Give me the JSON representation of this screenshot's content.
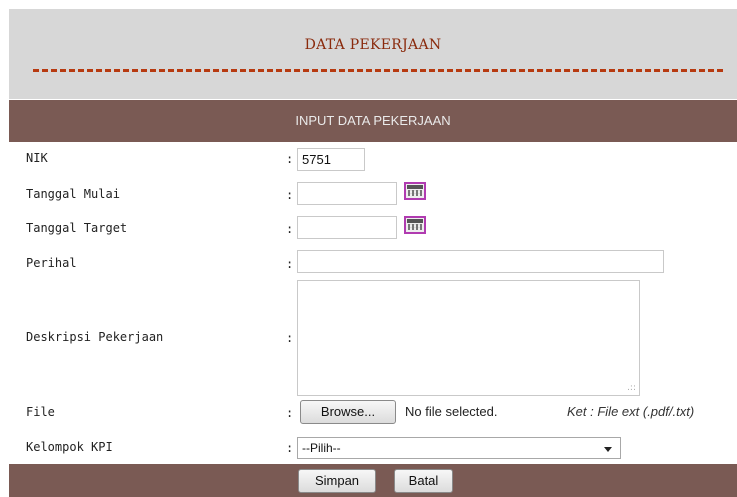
{
  "header": {
    "title": "DATA PEKERJAAN"
  },
  "subheader": {
    "title": "INPUT DATA PEKERJAAN"
  },
  "form": {
    "colon": ":",
    "nik": {
      "label": "NIK",
      "value": "5751"
    },
    "tanggal_mulai": {
      "label": "Tanggal Mulai",
      "value": ""
    },
    "tanggal_target": {
      "label": "Tanggal Target",
      "value": ""
    },
    "perihal": {
      "label": "Perihal",
      "value": ""
    },
    "deskripsi": {
      "label": "Deskripsi Pekerjaan",
      "value": ""
    },
    "file": {
      "label": "File",
      "browse_label": "Browse...",
      "status": "No file selected.",
      "note": "Ket : File ext (.pdf/.txt)"
    },
    "kelompok_kpi": {
      "label": "Kelompok KPI",
      "selected": "--Pilih--"
    }
  },
  "actions": {
    "save_label": "Simpan",
    "cancel_label": "Batal"
  },
  "colors": {
    "header_bg": "#d7d7d7",
    "title_color": "#8a2a0c",
    "bar_bg": "#7a5a54"
  }
}
